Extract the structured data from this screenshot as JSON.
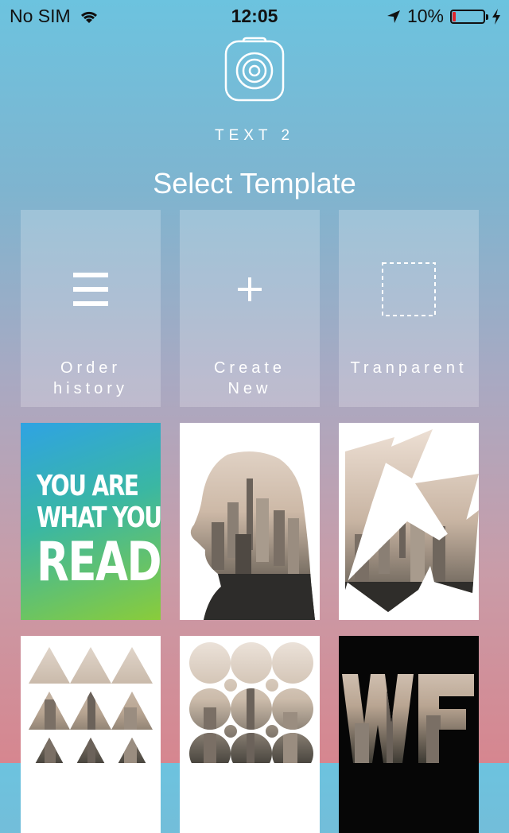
{
  "status_bar": {
    "carrier": "No SIM",
    "time": "12:05",
    "battery": "10%",
    "battery_level": 0.1,
    "battery_color": "#e0262b"
  },
  "app": {
    "name": "TEXT 2",
    "icon": "camera-icon"
  },
  "screen_title": "Select Template",
  "actions": [
    {
      "label_line1": "Order",
      "label_line2": "history",
      "icon": "menu-lines-icon"
    },
    {
      "label_line1": "Create",
      "label_line2": "New",
      "icon": "plus-icon"
    },
    {
      "label_line1": "Tranparent",
      "label_line2": "",
      "icon": "dashed-square-icon"
    }
  ],
  "templates": [
    {
      "name": "poster",
      "text_lines": [
        "YOU ARE",
        "WHAT YOUR",
        "READ"
      ]
    },
    {
      "name": "profile-silhouette-city"
    },
    {
      "name": "triangles-city"
    },
    {
      "name": "triangle-rows-city"
    },
    {
      "name": "circles-city"
    },
    {
      "name": "letters-city",
      "text": "WE"
    }
  ],
  "colors": {
    "bg_top": "#6cc3df",
    "bg_bottom": "#d6868f",
    "poster_gradient": [
      "#2fa3e3",
      "#3ab7a3",
      "#8acc3a"
    ]
  }
}
